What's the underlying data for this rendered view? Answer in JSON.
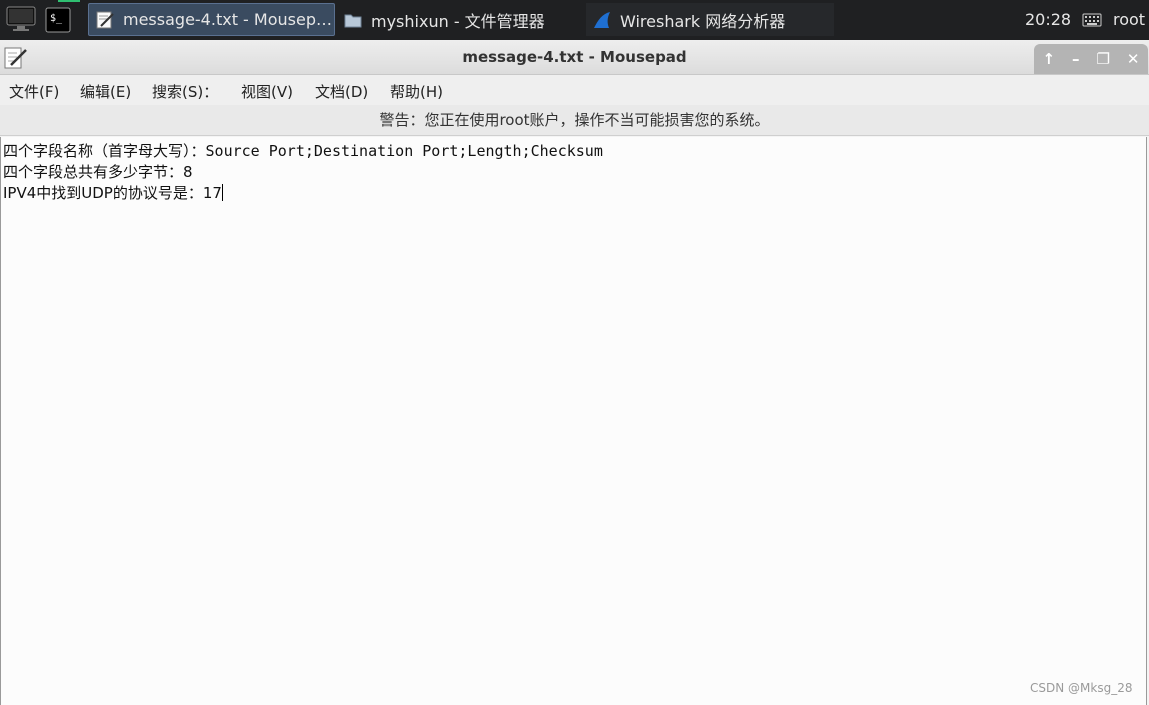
{
  "taskbar": {
    "tasks": [
      {
        "label": "message-4.txt - Mousep…",
        "icon": "text-editor-icon"
      },
      {
        "label": "myshixun - 文件管理器",
        "icon": "folder-icon"
      },
      {
        "label": "Wireshark 网络分析器",
        "icon": "wireshark-fin-icon"
      }
    ],
    "clock": "20:28",
    "user": "root"
  },
  "window": {
    "title": "message-4.txt - Mousepad"
  },
  "menu": {
    "items": [
      "文件(F)",
      "编辑(E)",
      "搜索(S)：",
      "视图(V)",
      "文档(D)",
      "帮助(H)"
    ]
  },
  "warning": "警告：您正在使用root账户，操作不当可能损害您的系统。",
  "editor": {
    "lines": [
      {
        "cn": "四个字段名称（首字母大写）：",
        "en": "Source Port;Destination Port;Length;Checksum"
      },
      {
        "cn": "四个字段总共有多少字节：",
        "en": "8"
      },
      {
        "cn": "IPV4中找到UDP的协议号是：",
        "en": "17"
      }
    ]
  },
  "watermark": "CSDN @Mksg_28"
}
